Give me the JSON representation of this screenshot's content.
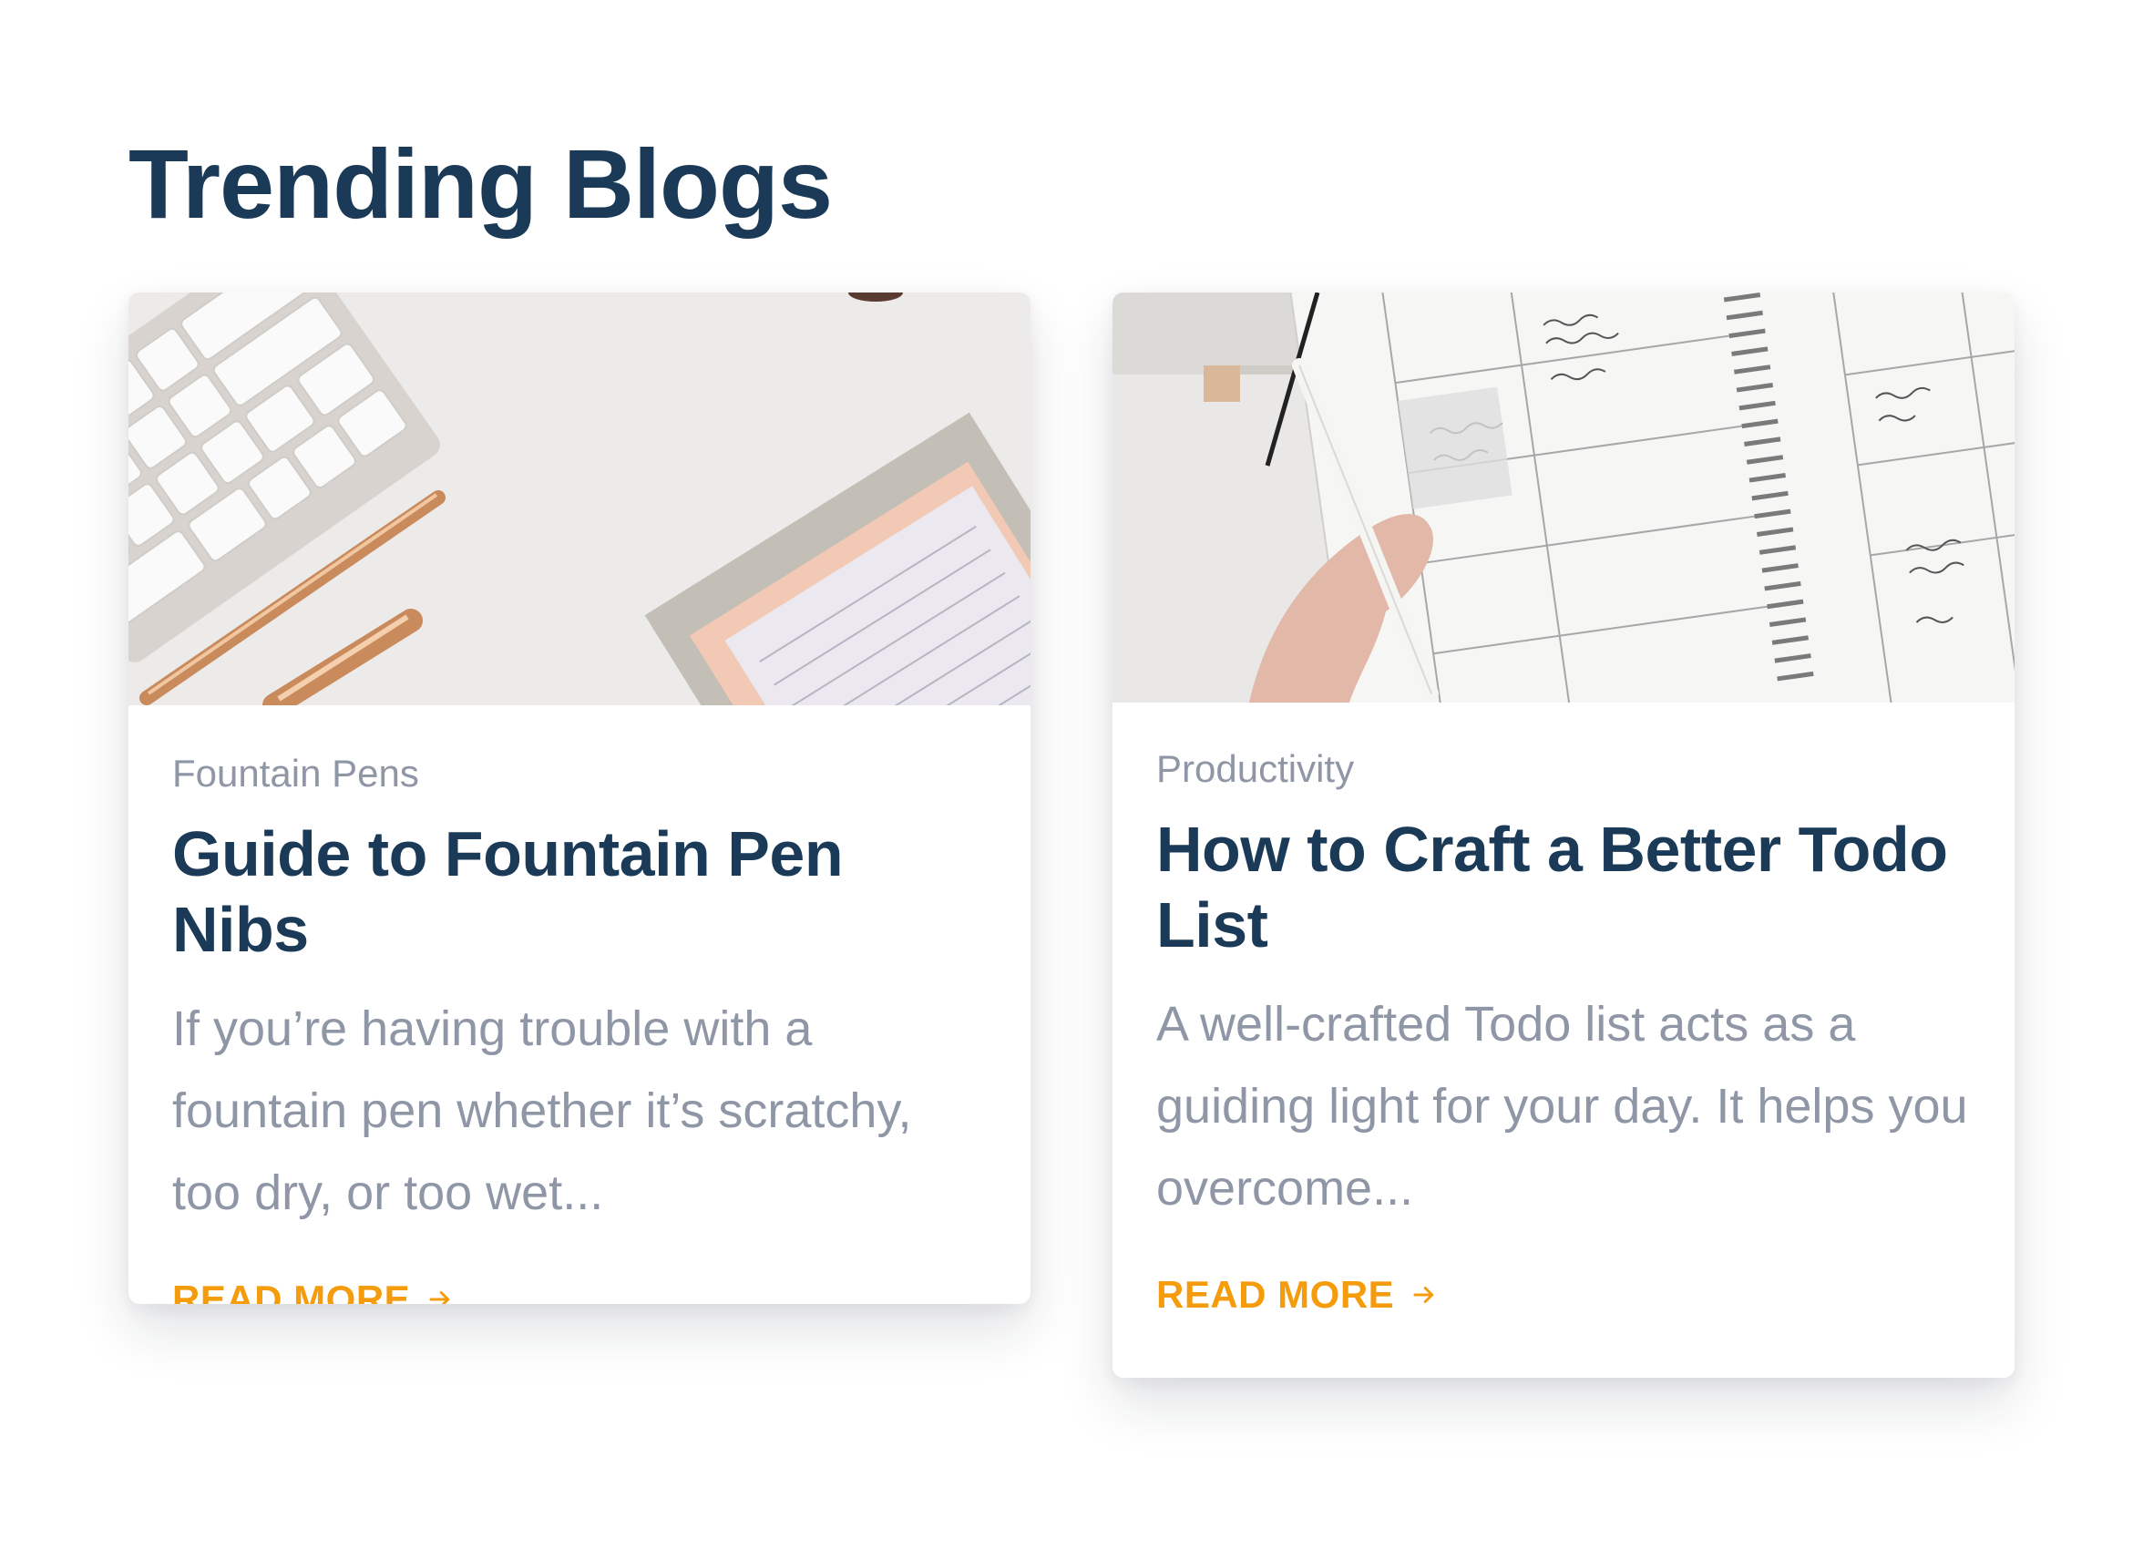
{
  "section": {
    "title": "Trending Blogs"
  },
  "cards": [
    {
      "image_alt": "Desk with keyboard, rose-gold pens and notepad",
      "category": "Fountain Pens",
      "title": "Guide to Fountain Pen Nibs",
      "excerpt": "If you’re having trouble with a fountain pen whether it’s scratchy, too dry, or too wet...",
      "cta": "READ MORE",
      "cta_icon": "arrow-right-icon"
    },
    {
      "image_alt": "Hand writing in a spiral weekly planner",
      "category": "Productivity",
      "title": "How to Craft a Better Todo List",
      "excerpt": "A well-crafted Todo list acts as a guiding light for your day. It helps you overcome...",
      "cta": "READ MORE",
      "cta_icon": "arrow-right-icon"
    }
  ],
  "colors": {
    "heading": "#1b3a57",
    "muted": "#8f97a6",
    "accent": "#f59c0d",
    "background": "#ffffff"
  }
}
